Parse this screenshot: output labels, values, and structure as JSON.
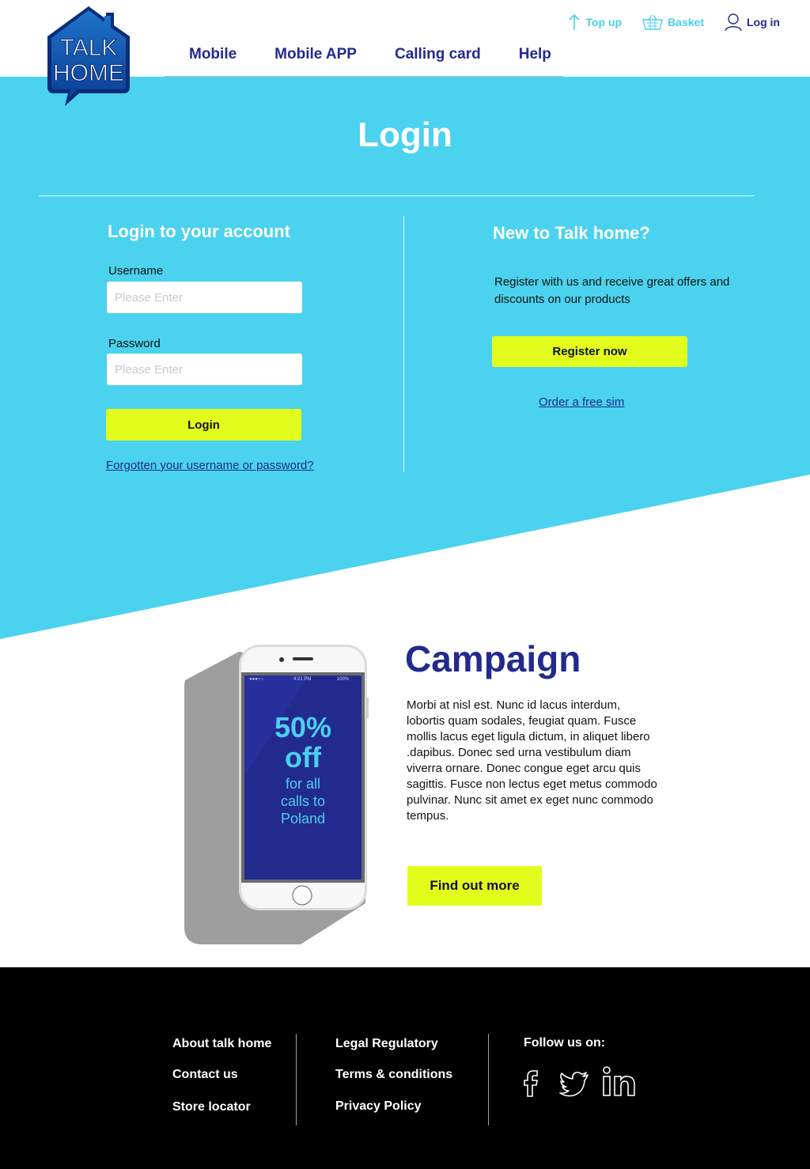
{
  "header": {
    "logo": {
      "line1": "TALK",
      "line2": "HOME"
    },
    "topbar": {
      "topup": "Top up",
      "basket": "Basket",
      "login": "Log in"
    },
    "nav": [
      "Mobile",
      "Mobile APP",
      "Calling card",
      "Help"
    ]
  },
  "page_title": "Login",
  "login": {
    "heading": "Login to your account",
    "username_label": "Username",
    "username_placeholder": "Please Enter",
    "password_label": "Password",
    "password_placeholder": "Please Enter",
    "login_button": "Login",
    "forgot_link": "Forgotten your username or password?"
  },
  "register": {
    "heading": "New to Talk home?",
    "text": "Register with us and receive great offers and discounts on our products",
    "button": "Register now",
    "free_sim_link": "Order a free sim"
  },
  "campaign": {
    "title": "Campaign",
    "body": "Morbi at nisl est. Nunc id lacus interdum, lobortis quam sodales, feugiat quam. Fusce mollis lacus eget ligula dictum, in aliquet libero .dapibus. Donec sed urna vestibulum diam viverra ornare. Donec congue eget arcu quis sagittis. Fusce non lectus eget metus commodo pulvinar. Nunc sit amet ex eget nunc commodo tempus.",
    "button": "Find out more",
    "phone": {
      "status_time": "4:21 PM",
      "status_battery": "100%",
      "promo_big": "50%",
      "promo_big2": "off",
      "promo_line1": "for all",
      "promo_line2": "calls to",
      "promo_line3": "Poland"
    }
  },
  "footer": {
    "col1": [
      "About talk home",
      "Contact us",
      "Store locator"
    ],
    "col2": [
      "Legal Regulatory",
      "Terms & conditions",
      "Privacy Policy"
    ],
    "follow": "Follow us on:",
    "social": [
      "facebook-icon",
      "twitter-icon",
      "linkedin-icon"
    ]
  },
  "colors": {
    "hero_blue": "#4bd2ee",
    "brand_navy": "#232a8e",
    "lime": "#e2fd1b",
    "footer_bg": "#000000"
  }
}
